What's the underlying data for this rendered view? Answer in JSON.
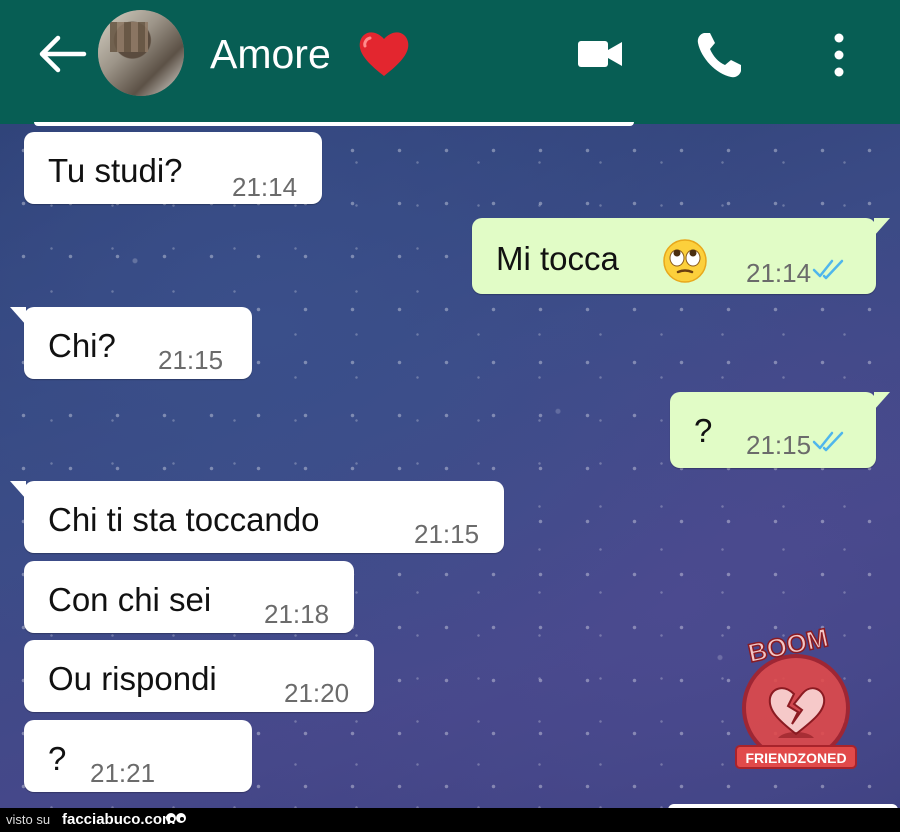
{
  "header": {
    "contact_name": "Amore",
    "icons": [
      "back-arrow-icon",
      "heart-emoji-icon",
      "video-call-icon",
      "phone-icon",
      "more-vert-icon"
    ],
    "bg_color": "#075e54"
  },
  "messages": [
    {
      "dir": "in",
      "text": "Tu studi?",
      "time": "21:14"
    },
    {
      "dir": "out",
      "text": "Mi tocca",
      "emoji": "rolling-eyes-emoji",
      "time": "21:14",
      "read": true
    },
    {
      "dir": "in",
      "text": "Chi?",
      "time": "21:15"
    },
    {
      "dir": "out",
      "text": "?",
      "time": "21:15",
      "read": true
    },
    {
      "dir": "in",
      "text": "Chi ti sta toccando",
      "time": "21:15"
    },
    {
      "dir": "in",
      "text": "Con chi sei",
      "time": "21:18"
    },
    {
      "dir": "in",
      "text": "Ou rispondi",
      "time": "21:20"
    },
    {
      "dir": "in",
      "text": "?",
      "time": "21:21"
    }
  ],
  "stamp": {
    "top_text": "BOOM",
    "bottom_text": "FRIENDZONED"
  },
  "footer": {
    "prefix": "visto su",
    "site": "facciabuco.com"
  },
  "colors": {
    "incoming_bubble": "#ffffff",
    "outgoing_bubble": "#e1fcc6",
    "read_ticks": "#4fb6ec"
  }
}
